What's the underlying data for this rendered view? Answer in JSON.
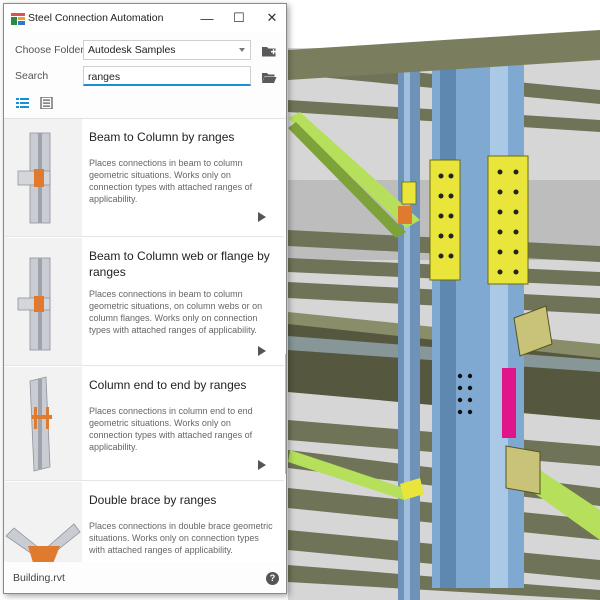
{
  "window": {
    "title": "Steel Connection Automation",
    "minimize_glyph": "—",
    "maximize_glyph": "☐",
    "close_glyph": "✕"
  },
  "filters": {
    "folder_label": "Choose Folder",
    "folder_value": "Autodesk Samples",
    "search_label": "Search",
    "search_value": "ranges"
  },
  "icons": {
    "app": "steel-connection-app-icon",
    "add_folder": "folder-add-icon",
    "open_folder": "folder-open-icon",
    "list_view": "list-view-icon",
    "detail_view": "detail-view-icon",
    "play": "play-icon",
    "help": "help-icon"
  },
  "connections": [
    {
      "name": "Beam to Column by ranges",
      "description": "Places connections in beam to column geometric situations. Works only on connection types with attached ranges of applicability."
    },
    {
      "name": "Beam to Column web or flange by ranges",
      "description": "Places connections in beam to column geometric situations, on column webs or on column flanges. Works only on connection types with attached ranges of applicability."
    },
    {
      "name": "Column end to end by ranges",
      "description": "Places connections in column end to end geometric situations. Works only on connection types with attached ranges of applicability."
    },
    {
      "name": "Double brace by ranges",
      "description": "Places connections in double brace geometric situations. Works only on connection types with attached ranges of applicability."
    }
  ],
  "footer": {
    "file_name": "Building.rvt",
    "help_glyph": "?"
  },
  "colors": {
    "accent_blue": "#1b8fd4",
    "connection_orange": "#e07a2e",
    "plate_yellow": "#e9e53a",
    "plate_magenta": "#e0158a",
    "brace_green": "#b6e05c",
    "column_blue": "#7fa9d0",
    "beam_olive": "#8a8d6a"
  }
}
